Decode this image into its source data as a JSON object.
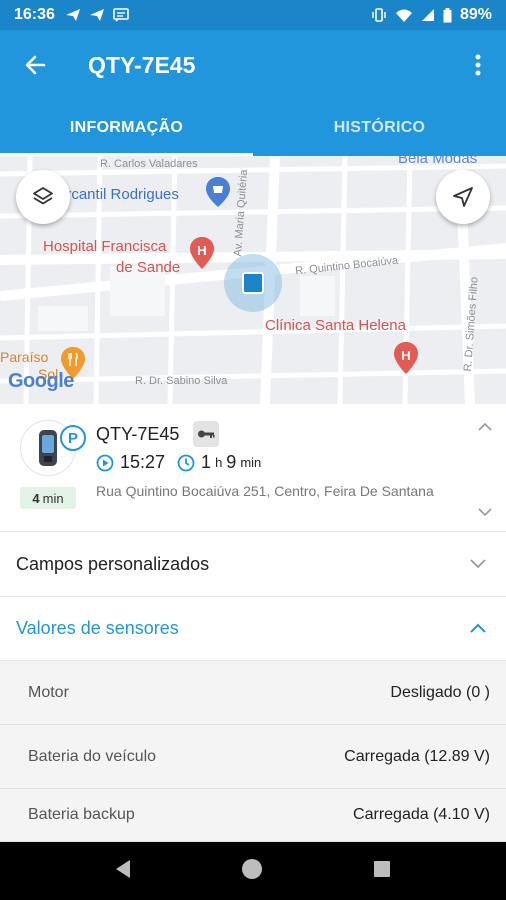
{
  "status_bar": {
    "time": "16:36",
    "battery": "89%",
    "icons": [
      "send-icon",
      "send-icon",
      "message-icon",
      "vibrate-icon",
      "wifi-icon",
      "signal-icon",
      "battery-icon"
    ]
  },
  "app_bar": {
    "title": "QTY-7E45",
    "icons": [
      "back-arrow-icon",
      "more-vert-icon"
    ]
  },
  "tabs": [
    {
      "label": "INFORMAÇÃO",
      "active": true
    },
    {
      "label": "HISTÓRICO",
      "active": false
    }
  ],
  "map": {
    "streets": [
      "R. Carlos Valadares",
      "R. Quintino Bocaiúva",
      "Av. Maria Quitéria",
      "R. Dr. Sabino Silva",
      "R. Dr. Simões Filho"
    ],
    "places": {
      "mercantil": "ercantil Rodrigues",
      "hospital_line1": "Hospital Francisca",
      "hospital_line2": "de Sande",
      "clinica": "Clínica Santa Helena",
      "paraiso_line1": "Paraíso",
      "paraiso_line2": "Sol",
      "bela": "Bela Modas"
    },
    "logo": "Google",
    "colors": {
      "accent": "#2196dc",
      "marker": "#1b85c9",
      "poi": "#d9534f"
    }
  },
  "vehicle": {
    "plate": "QTY-7E45",
    "parking_badge": "P",
    "time": "15:27",
    "duration_hours": "1",
    "duration_h_unit": "h",
    "duration_minutes": "9",
    "duration_min_unit": "min",
    "address": "Rua Quintino Bocaiúva 251, Centro, Feira De Santana",
    "stop_minutes": "4",
    "stop_unit": "min"
  },
  "sections": {
    "custom_fields": "Campos personalizados",
    "sensor_values": "Valores de sensores"
  },
  "sensors": [
    {
      "name": "Motor",
      "value": "Desligado (0 )"
    },
    {
      "name": "Bateria do veículo",
      "value": "Carregada (12.89 V)"
    },
    {
      "name": "Bateria backup",
      "value": "Carregada (4.10 V)"
    }
  ]
}
